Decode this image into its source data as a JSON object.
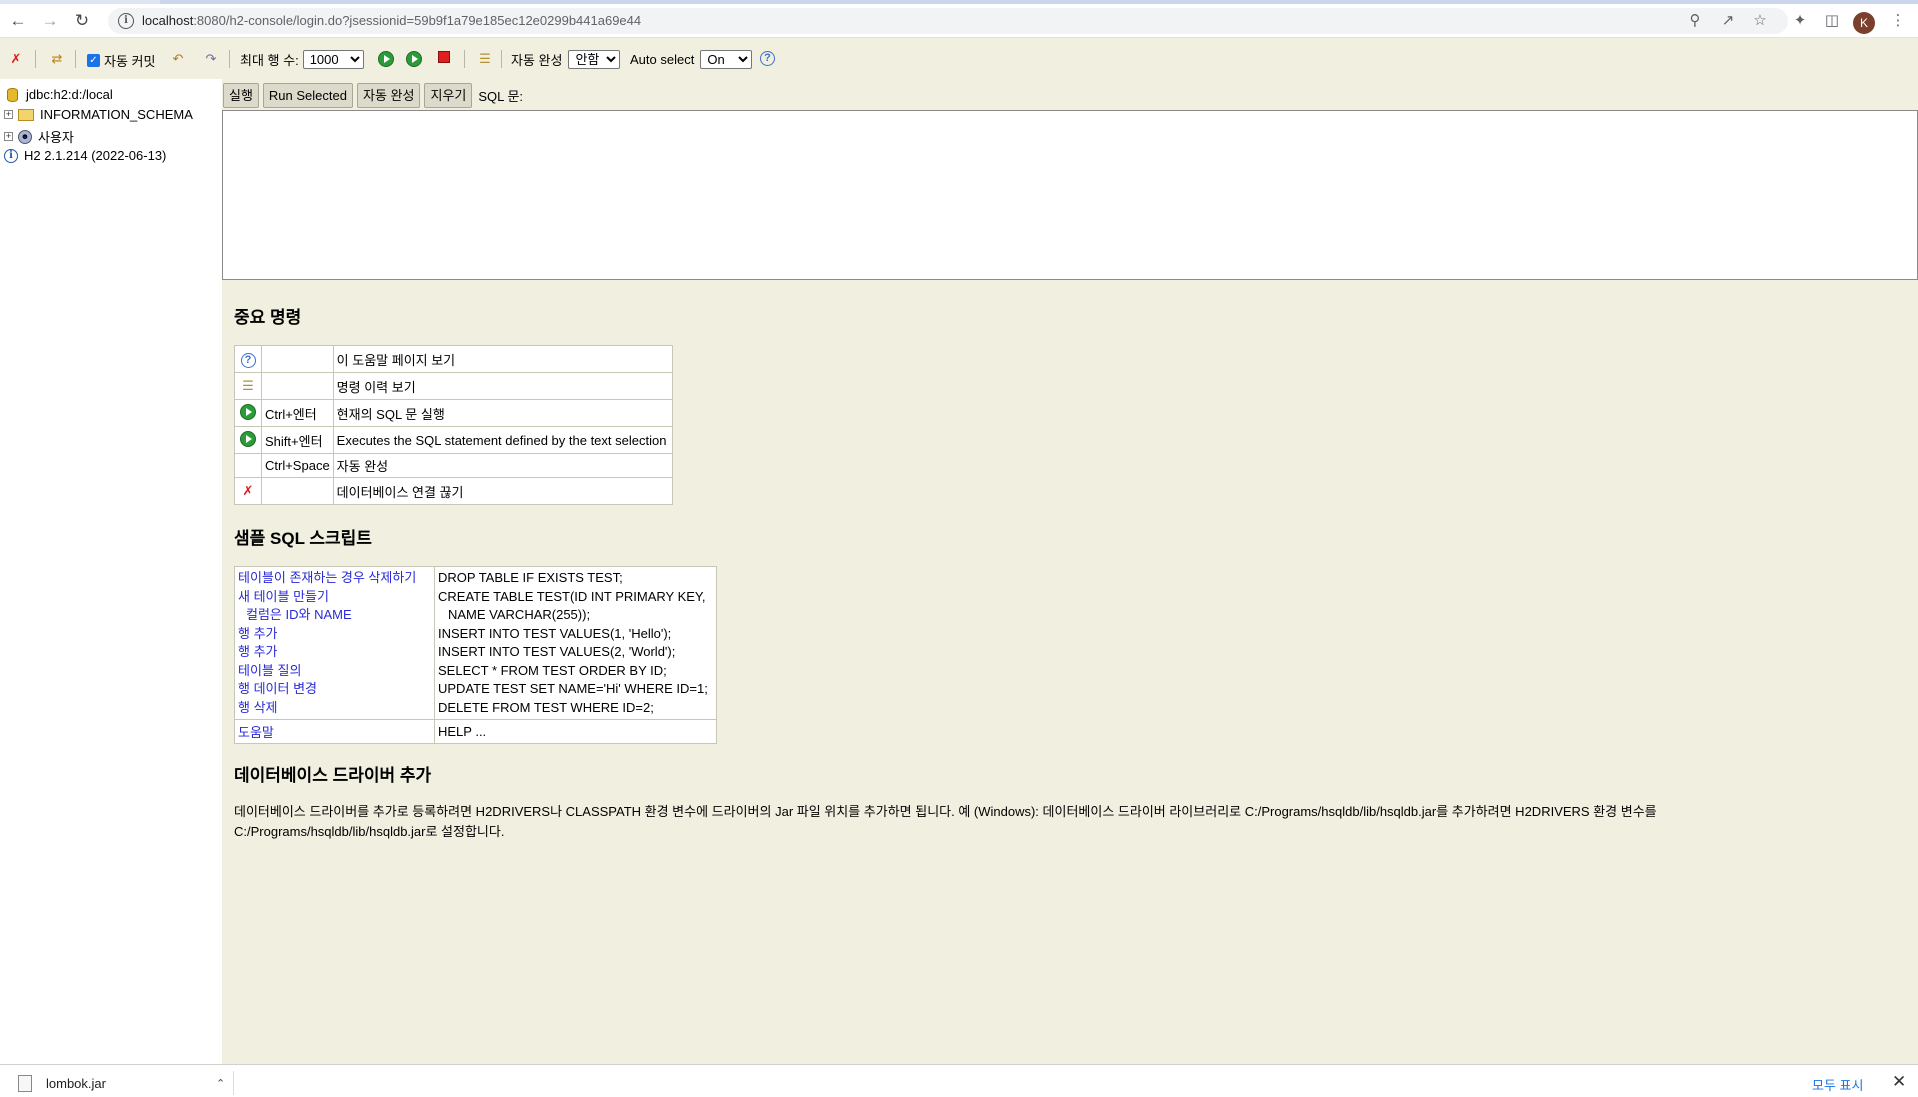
{
  "browser": {
    "url_host": "localhost",
    "url_rest": ":8080/h2-console/login.do?jsessionid=59b9f1a79e185ec12e0299b441a69e44",
    "avatar_letter": "K"
  },
  "toolbar": {
    "autocommit_label": "자동 커밋",
    "maxrows_label": "최대 행 수:",
    "maxrows_value": "1000",
    "autocomplete_label": "자동 완성",
    "autocomplete_value": "안함",
    "autoselect_label": "Auto select",
    "autoselect_value": "On"
  },
  "tree": {
    "connection": "jdbc:h2:d:/local",
    "schema": "INFORMATION_SCHEMA",
    "users": "사용자",
    "version": "H2 2.1.214 (2022-06-13)"
  },
  "editor": {
    "run_label": "실행",
    "run_selected_label": "Run Selected",
    "autocomplete_label": "자동 완성",
    "clear_label": "지우기",
    "sql_label": "SQL 문:"
  },
  "important": {
    "heading": "중요 명령",
    "rows": [
      {
        "key": "",
        "desc": "이 도움말 페이지 보기"
      },
      {
        "key": "",
        "desc": "명령 이력 보기"
      },
      {
        "key": "Ctrl+엔터",
        "desc": "현재의 SQL 문 실행"
      },
      {
        "key": "Shift+엔터",
        "desc": "Executes the SQL statement defined by the text selection"
      },
      {
        "key": "Ctrl+Space",
        "desc": "자동 완성"
      },
      {
        "key": "",
        "desc": "데이터베이스 연결 끊기"
      }
    ]
  },
  "sample": {
    "heading": "샘플 SQL 스크립트",
    "labels": [
      "테이블이 존재하는 경우 삭제하기",
      "새 테이블 만들기",
      "  컬럼은 ID와 NAME",
      "행 추가",
      "행 추가",
      "테이블 질의",
      "행 데이터 변경",
      "행 삭제"
    ],
    "sql": [
      "DROP TABLE IF EXISTS TEST;",
      "CREATE TABLE TEST(ID INT PRIMARY KEY,",
      "   NAME VARCHAR(255));",
      "INSERT INTO TEST VALUES(1, 'Hello');",
      "INSERT INTO TEST VALUES(2, 'World');",
      "SELECT * FROM TEST ORDER BY ID;",
      "UPDATE TEST SET NAME='Hi' WHERE ID=1;",
      "DELETE FROM TEST WHERE ID=2;"
    ],
    "help_label": "도움말",
    "help_sql": "HELP ..."
  },
  "driver": {
    "heading": "데이터베이스 드라이버 추가",
    "text": "데이터베이스 드라이버를 추가로 등록하려면 H2DRIVERS나 CLASSPATH 환경 변수에 드라이버의 Jar 파일 위치를 추가하면 됩니다. 예 (Windows): 데이터베이스 드라이버 라이브러리로 C:/Programs/hsqldb/lib/hsqldb.jar를 추가하려면 H2DRIVERS 환경 변수를 C:/Programs/hsqldb/lib/hsqldb.jar로 설정합니다."
  },
  "downloads": {
    "file": "lombok.jar",
    "show_all": "모두 표시"
  },
  "colors": {
    "background": "#f1efe0",
    "link": "#2a2ad8",
    "accent": "#1a73e8"
  }
}
